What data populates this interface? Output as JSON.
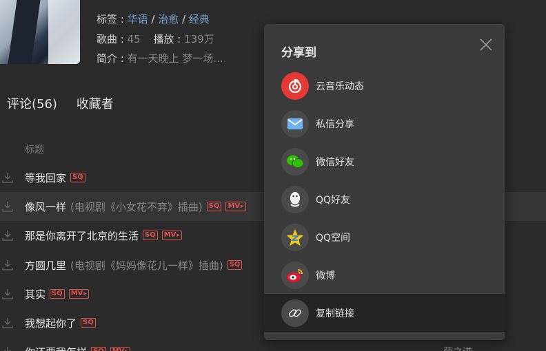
{
  "playlist": {
    "tags_label": "标签",
    "tags": [
      "华语",
      "治愈",
      "经典"
    ],
    "songs_label": "歌曲",
    "songs_count": "45",
    "plays_label": "播放",
    "plays_count": "139万",
    "intro_label": "简介",
    "intro_text": "有一天晚上 梦一场..."
  },
  "tabs": {
    "comments": "评论(56)",
    "collectors": "收藏者"
  },
  "list": {
    "header_title": "标题",
    "rows": [
      {
        "title": "等我回家",
        "subtitle": "",
        "sq": "SQ",
        "mv": "",
        "artist": ""
      },
      {
        "title": "像风一样",
        "subtitle": "(电视剧《小女花不弃》插曲)",
        "sq": "SQ",
        "mv": "MV",
        "artist": ""
      },
      {
        "title": "那是你离开了北京的生活",
        "subtitle": "",
        "sq": "SQ",
        "mv": "MV",
        "artist": ""
      },
      {
        "title": "方圆几里",
        "subtitle": "(电视剧《妈妈像花儿一样》插曲)",
        "sq": "SQ",
        "mv": "",
        "artist": ""
      },
      {
        "title": "其实",
        "subtitle": "",
        "sq": "SQ",
        "mv": "MV",
        "artist": ""
      },
      {
        "title": "我想起你了",
        "subtitle": "",
        "sq": "SQ",
        "mv": "",
        "artist": ""
      },
      {
        "title": "你还要我怎样",
        "subtitle": "",
        "sq": "SQ",
        "mv": "MV",
        "artist": "薛之谦"
      }
    ]
  },
  "share_popup": {
    "title": "分享到",
    "items": [
      {
        "label": "云音乐动态",
        "icon": "netease-cloud-music-icon",
        "color": "#e53935"
      },
      {
        "label": "私信分享",
        "icon": "mail-icon",
        "color": "#4a4a4a"
      },
      {
        "label": "微信好友",
        "icon": "wechat-icon",
        "color": "#4a4a4a"
      },
      {
        "label": "QQ好友",
        "icon": "qq-icon",
        "color": "#4a4a4a"
      },
      {
        "label": "QQ空间",
        "icon": "qzone-icon",
        "color": "#4a4a4a"
      },
      {
        "label": "微博",
        "icon": "weibo-icon",
        "color": "#4a4a4a"
      },
      {
        "label": "复制链接",
        "icon": "link-icon",
        "color": "#4a4a4a"
      }
    ]
  }
}
